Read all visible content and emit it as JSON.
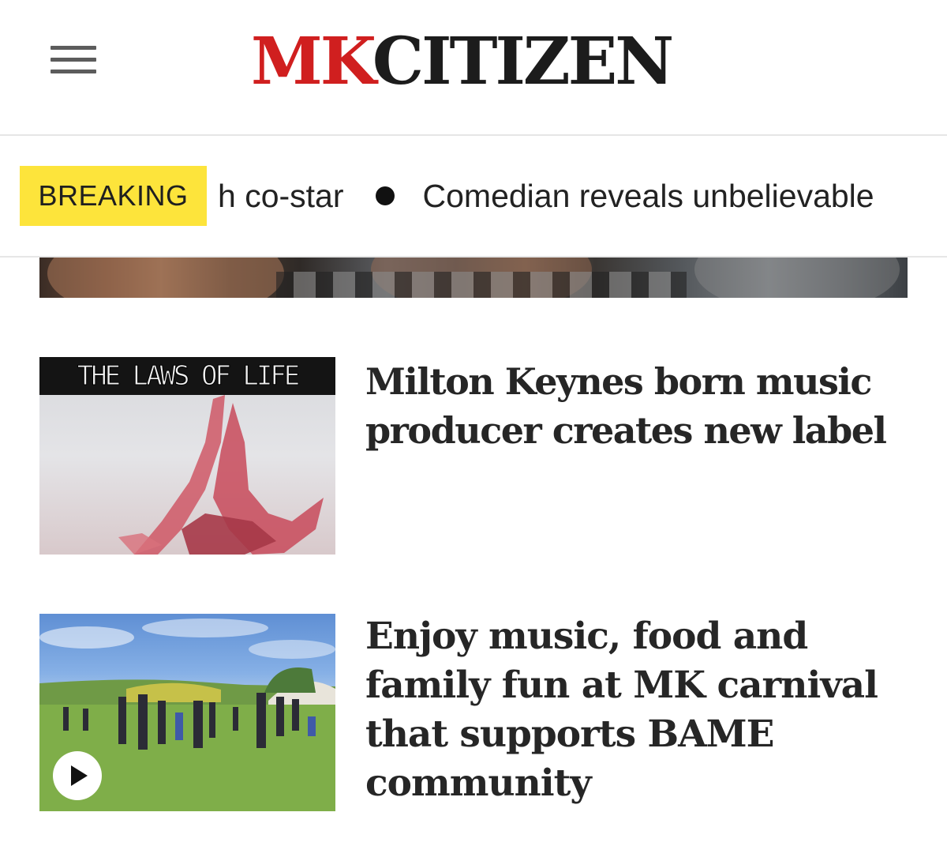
{
  "header": {
    "logo_mk": "MK",
    "logo_citizen": "CITIZEN",
    "menu_icon": "hamburger-menu-icon",
    "colors": {
      "logo_red": "#d01f1f",
      "logo_dark": "#1c1c1c"
    }
  },
  "ticker": {
    "badge": "BREAKING",
    "badge_color": "#fde43b",
    "items": [
      "h co-star",
      "Comedian reveals unbelievable"
    ],
    "separator_icon": "bullet-dot-icon"
  },
  "articles": [
    {
      "thumb_text": "THE LAWS OF LIFE",
      "headline": "Milton Keynes born music producer creates new label"
    },
    {
      "headline": "Enjoy music, food and family fun at MK carnival that supports BAME community",
      "play_icon": "play-icon"
    }
  ]
}
